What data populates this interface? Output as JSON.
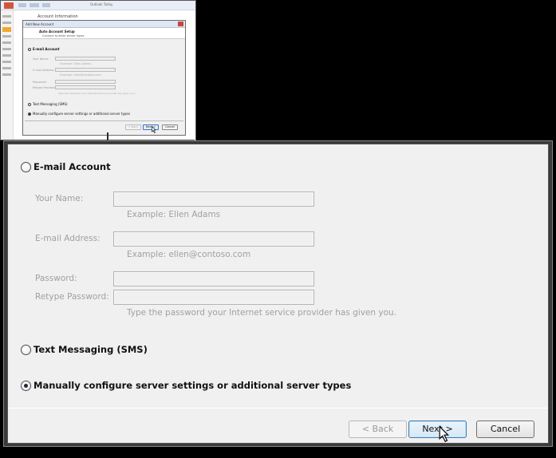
{
  "thumbnail": {
    "app_title": "Outlook Today",
    "main_title": "Account Information",
    "dialog_title": "Add New Account",
    "header_title": "Auto Account Setup",
    "header_subtitle": "Connect to other server types",
    "email_option": "E-mail Account",
    "labels": [
      "Your Name:",
      "E-mail Address:",
      "Password:",
      "Retype Password:"
    ],
    "examples": [
      "Example: Ellen Adams",
      "Example: ellen@contoso.com"
    ],
    "password_hint": "Type the password your Internet service provider has given you.",
    "sms_option": "Text Messaging (SMS)",
    "manual_option": "Manually configure server settings or additional server types",
    "back_button": "< Back",
    "next_button": "Next >",
    "cancel_button": "Cancel"
  },
  "dialog": {
    "email_account": {
      "label": "E-mail Account",
      "selected": false
    },
    "your_name": {
      "label": "Your Name:",
      "value": "",
      "example": "Example: Ellen Adams"
    },
    "email_address": {
      "label": "E-mail Address:",
      "value": "",
      "example": "Example: ellen@contoso.com"
    },
    "password": {
      "label": "Password:",
      "value": ""
    },
    "retype_password": {
      "label": "Retype Password:",
      "value": ""
    },
    "password_hint": "Type the password your Internet service provider has given you.",
    "sms": {
      "label": "Text Messaging (SMS)",
      "selected": false
    },
    "manual": {
      "label": "Manually configure server settings or additional server types",
      "selected": true
    },
    "buttons": {
      "back": "< Back",
      "next": "Next >",
      "cancel": "Cancel"
    }
  },
  "colors": {
    "accent": "#3c7fb1",
    "dialog_bg": "#f0f0f0",
    "disabled_text": "#a0a0a0"
  },
  "icons": {
    "cursor": "mouse-pointer-icon"
  }
}
